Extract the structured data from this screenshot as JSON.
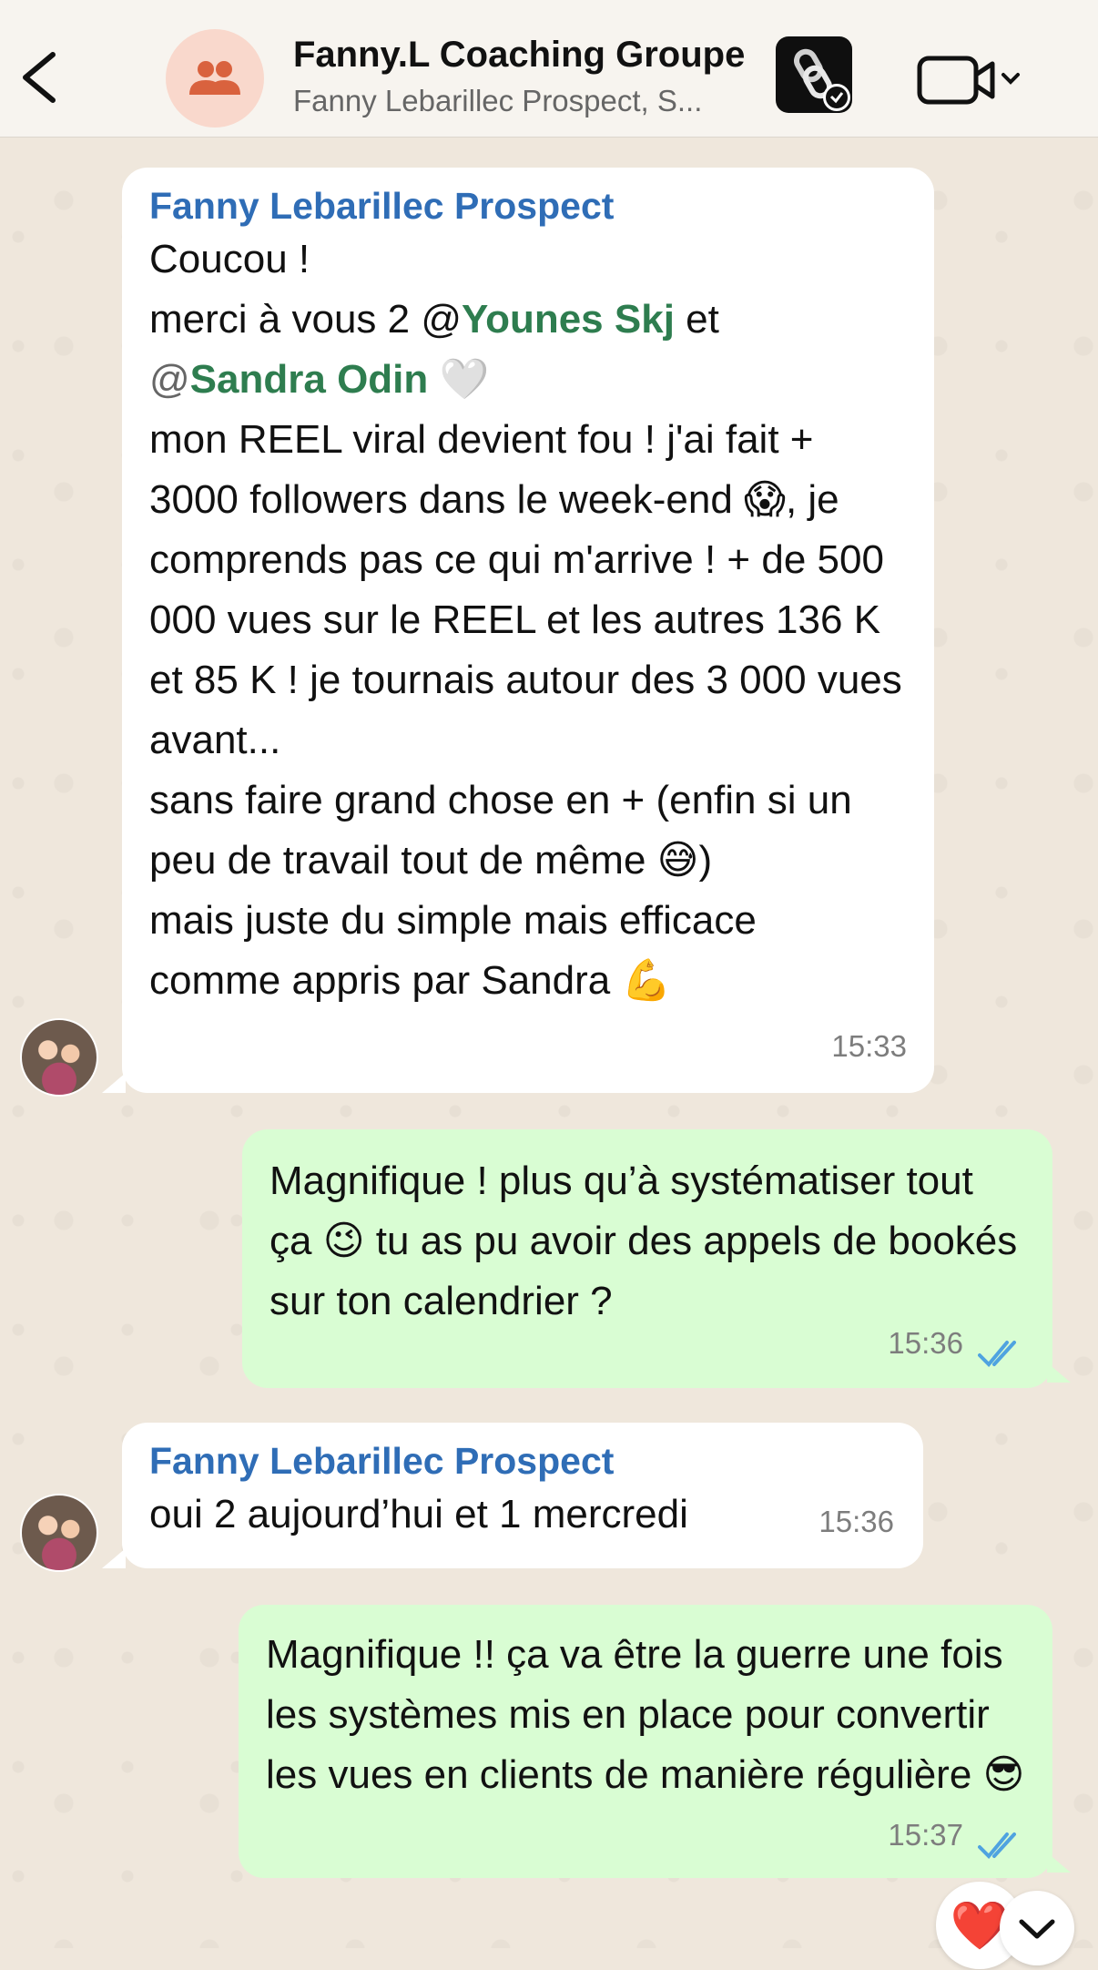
{
  "header": {
    "title": "Fanny.L Coaching Groupe",
    "subtitle": "Fanny Lebarillec Prospect, S..."
  },
  "messages": [
    {
      "sender": "Fanny Lebarillec Prospect",
      "line1": "Coucou !",
      "line2_pre": "merci à vous 2 @",
      "mention1": "Younes Skj",
      "line2_post": " et",
      "at": "@",
      "mention2": "Sandra Odin",
      "heart": "🤍",
      "body1": "mon REEL viral devient fou ! j'ai fait + 3000 followers dans le week-end ",
      "emoji1": "😱",
      "body2": ", je comprends pas ce qui m'arrive ! + de 500 000 vues sur le REEL et les autres 136 K et 85 K ! je tournais autour des 3 000 vues avant...",
      "body3": "sans faire grand chose en + (enfin si un peu de travail tout de même ",
      "emoji2": "😅",
      "body3_end": ")",
      "body4": "mais juste du simple mais efficace comme appris par Sandra ",
      "emoji3": "💪",
      "time": "15:33"
    },
    {
      "text_pre": "Magnifique ! plus qu’à systématiser tout ça ",
      "emoji": "😉",
      "text_post": " tu as pu avoir des appels de bookés sur ton calendrier ?",
      "time": "15:36"
    },
    {
      "sender": "Fanny Lebarillec Prospect",
      "text": "oui 2 aujourd’hui et 1 mercredi",
      "time": "15:36"
    },
    {
      "text_pre": "Magnifique !! ça va être la guerre une fois les systèmes mis en place pour convertir les vues en clients de manière régulière ",
      "emoji": "😎",
      "time": "15:37"
    }
  ],
  "reaction": "❤️",
  "colors": {
    "incoming": "#ffffff",
    "outgoing": "#d9fdd3",
    "sender": "#2f6db6",
    "mention": "#2e7d4f",
    "read_ticks": "#4fa3e0"
  }
}
